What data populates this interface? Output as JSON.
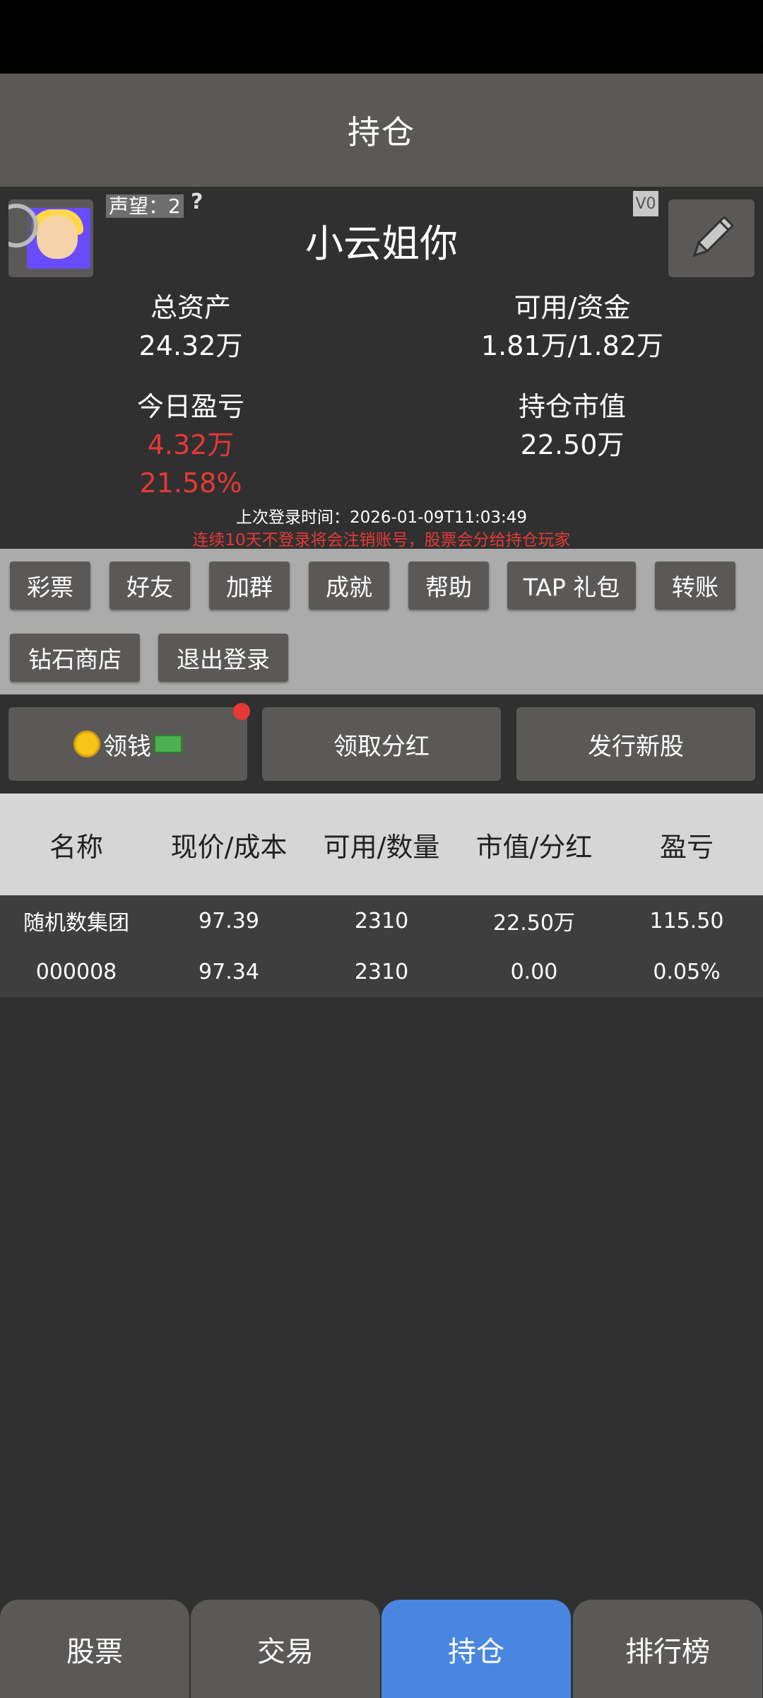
{
  "header": {
    "title": "持仓"
  },
  "profile": {
    "reputation_label": "声望：2",
    "reputation_help": "?",
    "vip_label": "V0",
    "username": "小云姐你",
    "avatar_icon": "avatar-girl",
    "edit_icon": "pencil-icon"
  },
  "stats": {
    "total_assets_label": "总资产",
    "total_assets_value": "24.32万",
    "available_funds_label": "可用/资金",
    "available_funds_value": "1.81万/1.82万",
    "today_pnl_label": "今日盈亏",
    "today_pnl_value": "4.32万",
    "today_pnl_percent": "21.58%",
    "position_value_label": "持仓市值",
    "position_value_value": "22.50万"
  },
  "login": {
    "last_login": "上次登录时间：2026-01-09T11:03:49",
    "warning": "连续10天不登录将会注销账号，股票会分给持仓玩家"
  },
  "menu": {
    "items": [
      "彩票",
      "好友",
      "加群",
      "成就",
      "帮助",
      "TAP 礼包",
      "转账",
      "钻石商店",
      "退出登录"
    ]
  },
  "actions": {
    "collect_money": "领钱",
    "collect_dividend": "领取分红",
    "issue_stock": "发行新股"
  },
  "table": {
    "headers": [
      "名称",
      "现价/成本",
      "可用/数量",
      "市值/分红",
      "盈亏"
    ],
    "rows": [
      [
        "随机数集团",
        "97.39",
        "2310",
        "22.50万",
        "115.50"
      ],
      [
        "000008",
        "97.34",
        "2310",
        "0.00",
        "0.05%"
      ]
    ]
  },
  "nav": {
    "tabs": [
      "股票",
      "交易",
      "持仓",
      "排行榜"
    ],
    "active": "持仓"
  },
  "colors": {
    "accent": "#4a86e0",
    "loss_red": "#e53935",
    "panel": "#5b5958",
    "background": "#303030"
  }
}
